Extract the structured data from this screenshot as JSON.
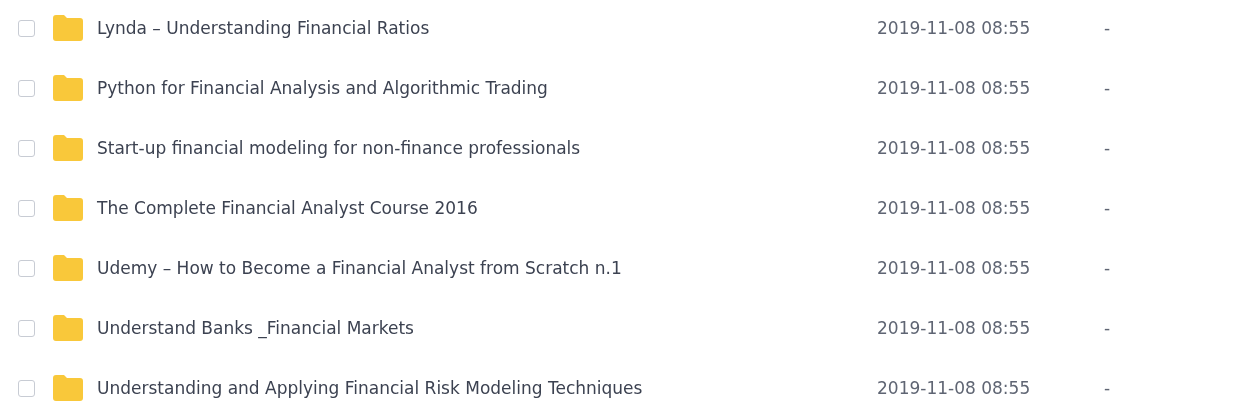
{
  "files": [
    {
      "name": "Lynda – Understanding Financial Ratios",
      "modified": "2019-11-08 08:55",
      "size": "-",
      "checked": false
    },
    {
      "name": "Python for Financial Analysis and Algorithmic Trading",
      "modified": "2019-11-08 08:55",
      "size": "-",
      "checked": false
    },
    {
      "name": "Start-up financial modeling for non-finance professionals",
      "modified": "2019-11-08 08:55",
      "size": "-",
      "checked": false
    },
    {
      "name": "The Complete Financial Analyst Course 2016",
      "modified": "2019-11-08 08:55",
      "size": "-",
      "checked": false
    },
    {
      "name": "Udemy – How to Become a Financial Analyst from Scratch n.1",
      "modified": "2019-11-08 08:55",
      "size": "-",
      "checked": false
    },
    {
      "name": "Understand Banks _Financial Markets",
      "modified": "2019-11-08 08:55",
      "size": "-",
      "checked": false
    },
    {
      "name": "Understanding and Applying Financial Risk Modeling Techniques",
      "modified": "2019-11-08 08:55",
      "size": "-",
      "checked": false
    }
  ]
}
